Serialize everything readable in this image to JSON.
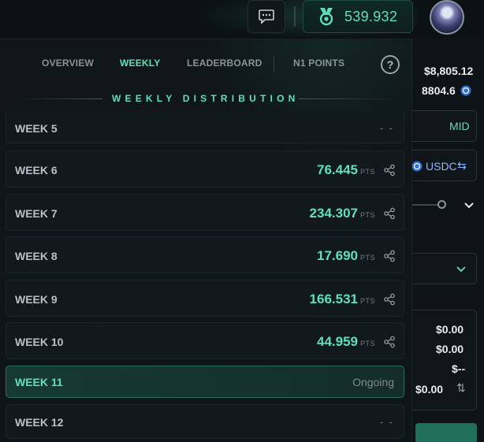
{
  "header": {
    "points_value": "539.932",
    "icons": [
      "chat-icon",
      "medal-icon",
      "avatar"
    ]
  },
  "right_panel": {
    "price_1": "$8,805.12",
    "price_2": "8804.6",
    "mid_label": "MID",
    "currency_label": "USDC",
    "summary_1": "$0.00",
    "summary_2": "$0.00",
    "summary_3": "$--",
    "summary_4": "$0.00"
  },
  "tabs": {
    "overview": "OVERVIEW",
    "weekly": "WEEKLY",
    "leaderboard": "LEADERBOARD",
    "n1_points": "N1 POINTS",
    "help": "?"
  },
  "section_title": "WEEKLY DISTRIBUTION",
  "weeks": [
    {
      "label": "WEEK 5",
      "points": "",
      "unit": "",
      "status": "- -"
    },
    {
      "label": "WEEK 6",
      "points": "76.445",
      "unit": "PTS",
      "status": ""
    },
    {
      "label": "WEEK 7",
      "points": "234.307",
      "unit": "PTS",
      "status": ""
    },
    {
      "label": "WEEK 8",
      "points": "17.690",
      "unit": "PTS",
      "status": ""
    },
    {
      "label": "WEEK 9",
      "points": "166.531",
      "unit": "PTS",
      "status": ""
    },
    {
      "label": "WEEK 10",
      "points": "44.959",
      "unit": "PTS",
      "status": ""
    },
    {
      "label": "WEEK 11",
      "points": "",
      "unit": "",
      "status": "Ongoing"
    },
    {
      "label": "WEEK 12",
      "points": "",
      "unit": "",
      "status": "- -"
    }
  ],
  "colors": {
    "accent": "#5fe0bd",
    "background": "#0c1114",
    "row": "#12191c",
    "current_row": "#163a33"
  }
}
